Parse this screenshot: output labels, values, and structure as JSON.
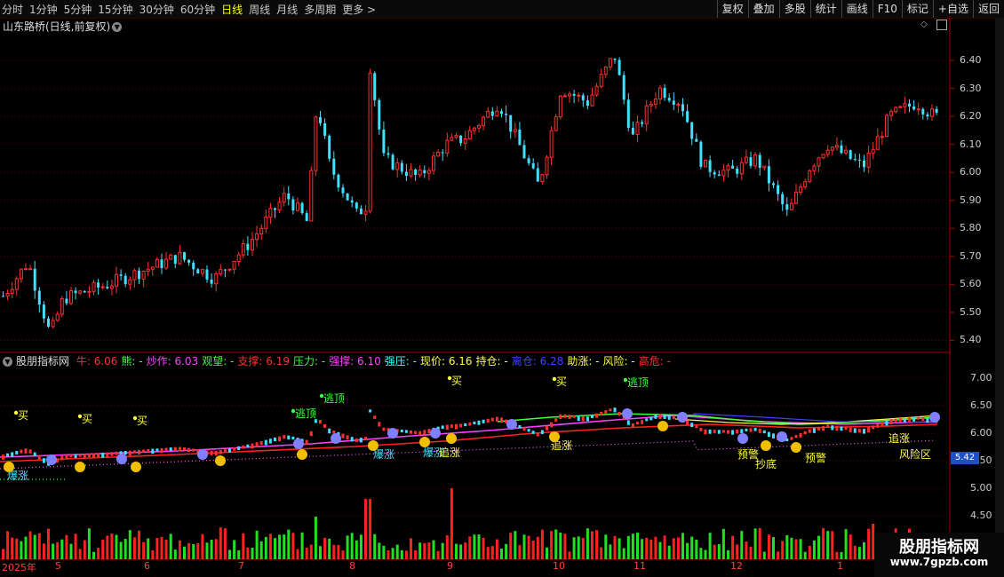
{
  "toolbar": {
    "periods": [
      "分时",
      "1分钟",
      "5分钟",
      "15分钟",
      "30分钟",
      "60分钟",
      "日线",
      "周线",
      "月线",
      "多周期",
      "更多"
    ],
    "active_period": "日线",
    "buttons": [
      "复权",
      "叠加",
      "多股",
      "统计",
      "画线",
      "F10",
      "标记",
      "+自选",
      "返回"
    ]
  },
  "chart_title": "山东路桥(日线,前复权)",
  "price_axis": [
    "6.40",
    "6.30",
    "6.20",
    "6.10",
    "6.00",
    "5.90",
    "5.80",
    "5.70",
    "5.60",
    "5.50",
    "5.40"
  ],
  "indicator": {
    "name": "股朋指标网",
    "fields": [
      {
        "label": "牛:",
        "value": "6.06",
        "color": "#ff3030"
      },
      {
        "label": "熊:",
        "value": "-",
        "color": "#40ff40"
      },
      {
        "label": "炒作:",
        "value": "6.03",
        "color": "#ff40ff"
      },
      {
        "label": "观望:",
        "value": "-",
        "color": "#40ff40"
      },
      {
        "label": "支撑:",
        "value": "6.19",
        "color": "#ff3030"
      },
      {
        "label": "压力:",
        "value": "-",
        "color": "#40ff40"
      },
      {
        "label": "强撑:",
        "value": "6.10",
        "color": "#ff40ff"
      },
      {
        "label": "强压:",
        "value": "-",
        "color": "#40ffff"
      },
      {
        "label": "现价:",
        "value": "6.16",
        "color": "#ffff40"
      },
      {
        "label": "持仓:",
        "value": "-",
        "color": "#ffff40"
      },
      {
        "label": "离仓:",
        "value": "6.28",
        "color": "#4040ff"
      },
      {
        "label": "助涨:",
        "value": "-",
        "color": "#ffff40"
      },
      {
        "label": "风险:",
        "value": "-",
        "color": "#ffff40"
      },
      {
        "label": "高危:",
        "value": "-",
        "color": "#ff3030"
      }
    ]
  },
  "indicator_axis": [
    "7.00",
    "6.50",
    "6.00",
    "5.50",
    "5.00",
    "4.50"
  ],
  "price_tag": "5.42",
  "date_axis": [
    "2025年",
    "5",
    "6",
    "7",
    "8",
    "9",
    "10",
    "11",
    "12",
    "1"
  ],
  "signals": [
    "买",
    "买",
    "买",
    "逃顶",
    "逃顶",
    "买",
    "买",
    "逃顶",
    "爆涨",
    "爆涨",
    "爆涨",
    "追涨",
    "追涨",
    "追涨",
    "预警",
    "预警",
    "抄底",
    "风险区"
  ],
  "watermark": {
    "title": "股朋指标网",
    "url": "www.7gpzb.com"
  }
}
